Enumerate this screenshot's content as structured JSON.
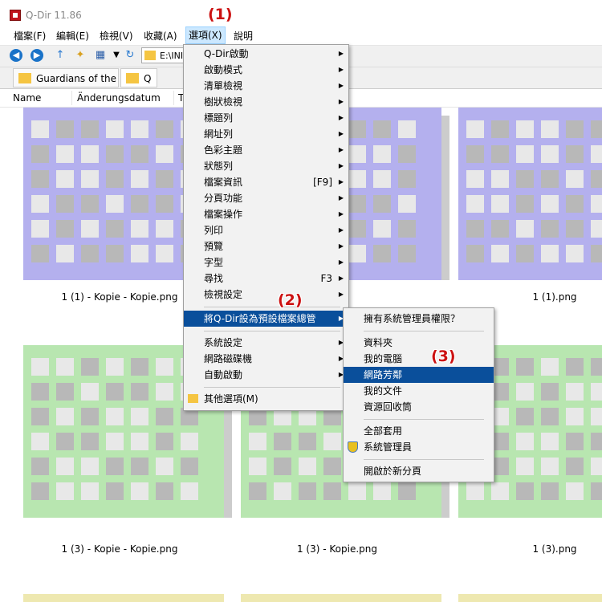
{
  "window": {
    "title": "Q-Dir 11.86"
  },
  "menubar": [
    {
      "label": "檔案(F)"
    },
    {
      "label": "編輯(E)"
    },
    {
      "label": "檢視(V)"
    },
    {
      "label": "收藏(A)"
    },
    {
      "label": "選項(X)"
    },
    {
      "label": "說明"
    }
  ],
  "address": {
    "value": "E:\\INI"
  },
  "tabs": [
    {
      "label": "Guardians of the ..."
    },
    {
      "label": "Q"
    }
  ],
  "columns": [
    {
      "label": "Name"
    },
    {
      "label": "Änderungsdatum"
    },
    {
      "label": "T"
    }
  ],
  "files": [
    {
      "name": "1 (1) - Kopie - Kopie.png"
    },
    {
      "name": "1 (1).png"
    },
    {
      "name": "1 (3) - Kopie - Kopie.png"
    },
    {
      "name": "1 (3) - Kopie.png"
    },
    {
      "name": "1 (3).png"
    }
  ],
  "options_menu": [
    {
      "label": "Q-Dir啟動",
      "arrow": "▶"
    },
    {
      "label": "啟動模式",
      "arrow": "▶"
    },
    {
      "label": "清單檢視",
      "arrow": "▶"
    },
    {
      "label": "樹狀檢視",
      "arrow": "▶"
    },
    {
      "label": "標題列",
      "arrow": "▶"
    },
    {
      "label": "網址列",
      "arrow": "▶"
    },
    {
      "label": "色彩主題",
      "arrow": "▶"
    },
    {
      "label": "狀態列",
      "arrow": "▶"
    },
    {
      "label": "檔案資訊",
      "shortcut": "[F9]",
      "arrow": "▶"
    },
    {
      "label": "分頁功能",
      "arrow": "▶"
    },
    {
      "label": "檔案操作",
      "arrow": "▶"
    },
    {
      "label": "列印",
      "arrow": "▶"
    },
    {
      "label": "預覽",
      "arrow": "▶"
    },
    {
      "label": "字型",
      "arrow": "▶"
    },
    {
      "label": "尋找",
      "shortcut": "F3",
      "arrow": "▶"
    },
    {
      "label": "檢視設定",
      "arrow": "▶"
    },
    {
      "label": "將Q-Dir設為預設檔案總管",
      "arrow": "▶"
    },
    {
      "label": "系統設定",
      "arrow": "▶"
    },
    {
      "label": "網路磁碟機",
      "arrow": "▶"
    },
    {
      "label": "自動啟動",
      "arrow": "▶"
    },
    {
      "label": "其他選項(M)"
    }
  ],
  "submenu": [
    {
      "label": "擁有系統管理員權限？"
    },
    {
      "label": "資料夾"
    },
    {
      "label": "我的電腦"
    },
    {
      "label": "網路芳鄰"
    },
    {
      "label": "我的文件"
    },
    {
      "label": "資源回收筒"
    },
    {
      "label": "全部套用"
    },
    {
      "label": "系統管理員"
    },
    {
      "label": "開啟於新分頁"
    }
  ],
  "annotations": [
    "(1)",
    "(2)",
    "(3)"
  ],
  "colors": {
    "highlight": "#0a4f9b",
    "annotation": "#cc1111"
  }
}
